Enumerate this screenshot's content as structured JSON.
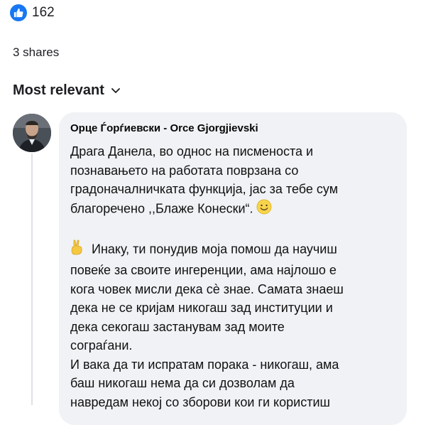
{
  "reactions": {
    "count": "162",
    "icon": "like-icon"
  },
  "shares_label": "3 shares",
  "sort_label": "Most relevant",
  "comment": {
    "author": "Орце Ѓорѓиевски - Orce Gjorgjievski",
    "p1": [
      "Драга Данела, во однос на писменоста и",
      "познавањето на работата поврзана со",
      "градоначалничката функција, јас за тебе сум",
      "благоречено ,,Блаже Конески“."
    ],
    "p2": [
      "Инаку, ти понудив моја помош да научиш",
      "повеќе за своите ингеренции, ама најлошо е",
      "кога човек мисли дека сѐ знае. Самата знаеш",
      "дека не се кријам никогаш зад институции и",
      "дека секогаш застанувам зад моите",
      "сограѓани."
    ],
    "p3": [
      "И вака да ти испратам порака - никогаш, ама",
      "баш никогаш нема да си дозволам да",
      "навредам некој со зборови кои ги користиш"
    ]
  },
  "colors": {
    "like_blue": "#1877f2",
    "bubble_bg": "#f0f2f5"
  }
}
